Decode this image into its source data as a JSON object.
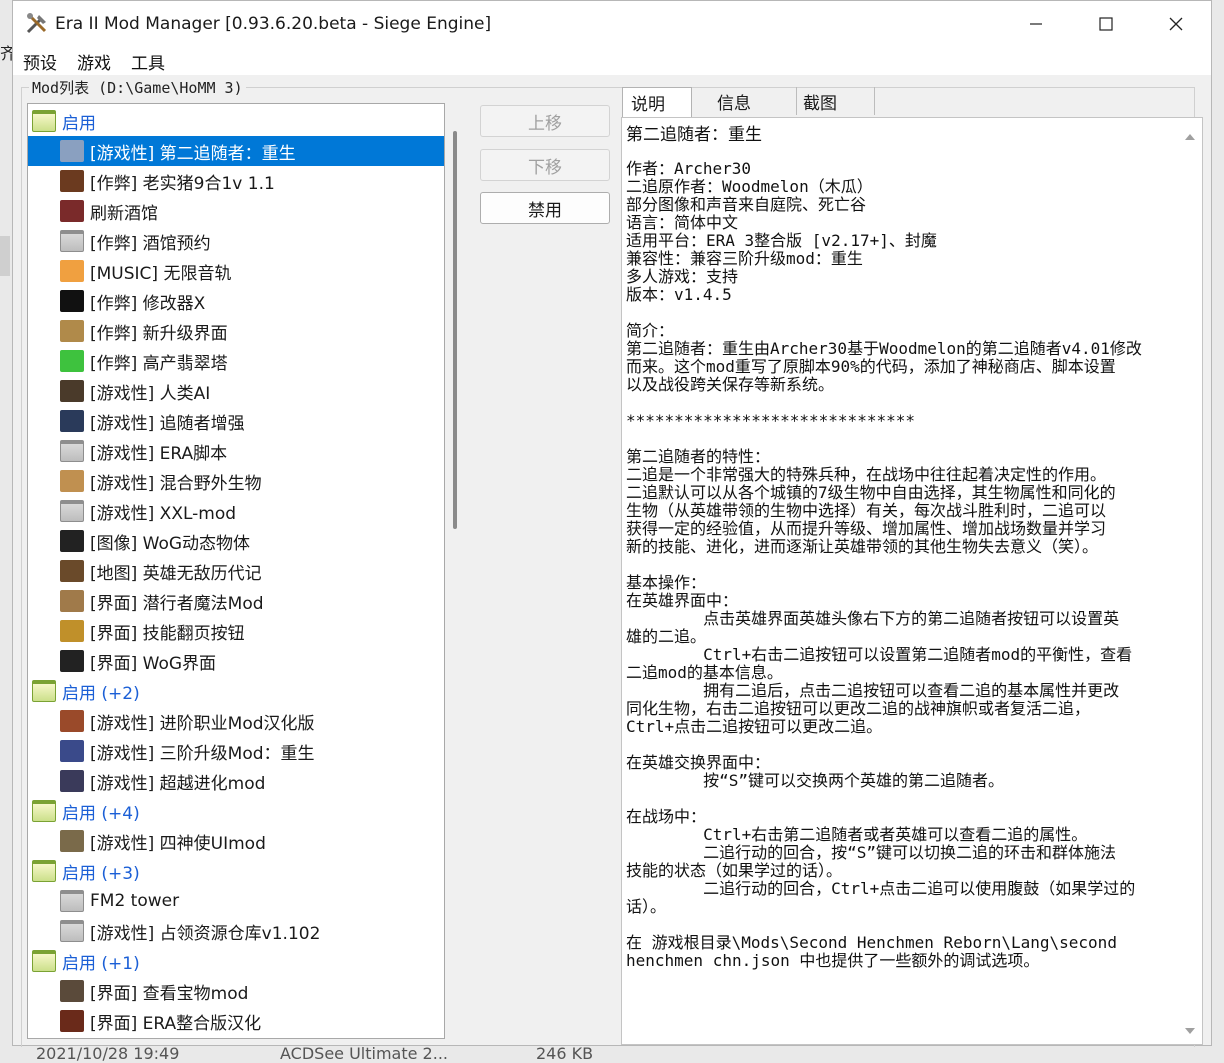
{
  "window": {
    "title": "Era II Mod Manager [0.93.6.20.beta - Siege Engine]",
    "controls": {
      "minimize": "minimize-icon",
      "maximize": "maximize-icon",
      "close": "close-icon"
    }
  },
  "menu": {
    "items": [
      "预设",
      "游戏",
      "工具"
    ]
  },
  "modlist": {
    "legend": "Mod列表 (D:\\Game\\HoMM 3)",
    "rows": [
      {
        "type": "group",
        "label": "启用",
        "icon": "folder-icon",
        "color": ""
      },
      {
        "type": "item",
        "label": "[游戏性] 第二追随者：重生",
        "icon": "knight-icon",
        "color": "#8aa0c0",
        "selected": true
      },
      {
        "type": "item",
        "label": "[作弊] 老实猪9合1v 1.1",
        "icon": "mod-icon",
        "color": "#6b3a1f"
      },
      {
        "type": "item",
        "label": "刷新酒馆",
        "icon": "tavern-icon",
        "color": "#7a2a2a"
      },
      {
        "type": "item",
        "label": "[作弊] 酒馆预约",
        "icon": "folder-icon",
        "color": ""
      },
      {
        "type": "item",
        "label": "[MUSIC] 无限音轨",
        "icon": "music-icon",
        "color": "#f0a040"
      },
      {
        "type": "item",
        "label": "[作弊] 修改器X",
        "icon": "skull-icon",
        "color": "#111111"
      },
      {
        "type": "item",
        "label": "[作弊] 新升级界面",
        "icon": "upgrade-icon",
        "color": "#b08a4a"
      },
      {
        "type": "item",
        "label": "[作弊] 高产翡翠塔",
        "icon": "emerald-icon",
        "color": "#3ec23e"
      },
      {
        "type": "item",
        "label": "[游戏性] 人类AI",
        "icon": "portrait-icon",
        "color": "#4a3a2a"
      },
      {
        "type": "item",
        "label": "[游戏性] 追随者增强",
        "icon": "follower-icon",
        "color": "#2a3a5a"
      },
      {
        "type": "item",
        "label": "[游戏性] ERA脚本",
        "icon": "folder-icon",
        "color": ""
      },
      {
        "type": "item",
        "label": "[游戏性] 混合野外生物",
        "icon": "creature-icon",
        "color": "#c09050"
      },
      {
        "type": "item",
        "label": "[游戏性] XXL-mod",
        "icon": "folder-icon",
        "color": ""
      },
      {
        "type": "item",
        "label": "[图像] WoG动态物体",
        "icon": "wog-icon",
        "color": "#222222"
      },
      {
        "type": "item",
        "label": "[地图] 英雄无敌历代记",
        "icon": "map-icon",
        "color": "#6a4a2a"
      },
      {
        "type": "item",
        "label": "[界面] 潜行者魔法Mod",
        "icon": "magic-icon",
        "color": "#a07a4a"
      },
      {
        "type": "item",
        "label": "[界面] 技能翻页按钮",
        "icon": "skill-icon",
        "color": "#c0902a"
      },
      {
        "type": "item",
        "label": "[界面] WoG界面",
        "icon": "wog-icon",
        "color": "#222222"
      },
      {
        "type": "group",
        "label": "启用 (+2)",
        "icon": "folder-icon",
        "color": ""
      },
      {
        "type": "item",
        "label": "[游戏性] 进阶职业Mod汉化版",
        "icon": "shield-icon",
        "color": "#9a4a2a"
      },
      {
        "type": "item",
        "label": "[游戏性] 三阶升级Mod：重生",
        "icon": "orb-icon",
        "color": "#3a4a8a"
      },
      {
        "type": "item",
        "label": "[游戏性] 超越进化mod",
        "icon": "portrait-icon",
        "color": "#3a3a5a"
      },
      {
        "type": "group",
        "label": "启用 (+4)",
        "icon": "folder-icon",
        "color": ""
      },
      {
        "type": "item",
        "label": "[游戏性] 四神使UImod",
        "icon": "gear-icon",
        "color": "#7a6a4a"
      },
      {
        "type": "group",
        "label": "启用 (+3)",
        "icon": "folder-icon",
        "color": ""
      },
      {
        "type": "item",
        "label": "FM2 tower",
        "icon": "folder-icon",
        "color": ""
      },
      {
        "type": "item",
        "label": "[游戏性] 占领资源仓库v1.102",
        "icon": "folder-icon",
        "color": ""
      },
      {
        "type": "group",
        "label": "启用 (+1)",
        "icon": "folder-icon",
        "color": ""
      },
      {
        "type": "item",
        "label": "[界面] 查看宝物mod",
        "icon": "artifact-icon",
        "color": "#5a4a3a"
      },
      {
        "type": "item",
        "label": "[界面] ERA整合版汉化",
        "icon": "era-icon",
        "color": "#6a2a1a"
      }
    ]
  },
  "buttons": {
    "move_up": "上移",
    "move_down": "下移",
    "disable": "禁用"
  },
  "tabs": [
    "说明",
    "信息",
    "截图"
  ],
  "description": {
    "title": "第二追随者：重生",
    "body": "作者：Archer30\n二追原作者：Woodmelon（木瓜）\n部分图像和声音来自庭院、死亡谷\n语言：简体中文\n适用平台：ERA 3整合版 [v2.17+]、封魔\n兼容性：兼容三阶升级mod：重生\n多人游戏：支持\n版本：v1.4.5\n\n简介：\n第二追随者：重生由Archer30基于Woodmelon的第二追随者v4.01修改\n而来。这个mod重写了原脚本90%的代码，添加了神秘商店、脚本设置\n以及战役跨关保存等新系统。\n\n******************************\n\n第二追随者的特性：\n二追是一个非常强大的特殊兵种，在战场中往往起着决定性的作用。\n二追默认可以从各个城镇的7级生物中自由选择，其生物属性和同化的\n生物（从英雄带领的生物中选择）有关，每次战斗胜利时，二追可以\n获得一定的经验值，从而提升等级、增加属性、增加战场数量并学习\n新的技能、进化，进而逐渐让英雄带领的其他生物失去意义（笑）。\n\n基本操作：\n在英雄界面中：\n        点击英雄界面英雄头像右下方的第二追随者按钮可以设置英\n雄的二追。\n        Ctrl+右击二追按钮可以设置第二追随者mod的平衡性，查看\n二追mod的基本信息。\n        拥有二追后，点击二追按钮可以查看二追的基本属性并更改\n同化生物，右击二追按钮可以更改二追的战神旗帜或者复活二追，\nCtrl+点击二追按钮可以更改二追。\n\n在英雄交换界面中：\n        按“S”键可以交换两个英雄的第二追随者。\n\n在战场中：\n        Ctrl+右击第二追随者或者英雄可以查看二追的属性。\n        二追行动的回合，按“S”键可以切换二追的环击和群体施法\n技能的状态（如果学过的话）。\n        二追行动的回合，Ctrl+点击二追可以使用腹鼓（如果学过的\n话）。\n\n在 游戏根目录\\Mods\\Second Henchmen Reborn\\Lang\\second\nhenchmen chn.json 中也提供了一些额外的调试选项。"
  },
  "background": {
    "left_char": "齐",
    "bottom": [
      "2021/10/28 19:49",
      "ACDSee Ultimate 2...",
      "246 KB"
    ]
  },
  "colors": {
    "selection": "#0078d7",
    "group_text": "#1b5fd6"
  }
}
